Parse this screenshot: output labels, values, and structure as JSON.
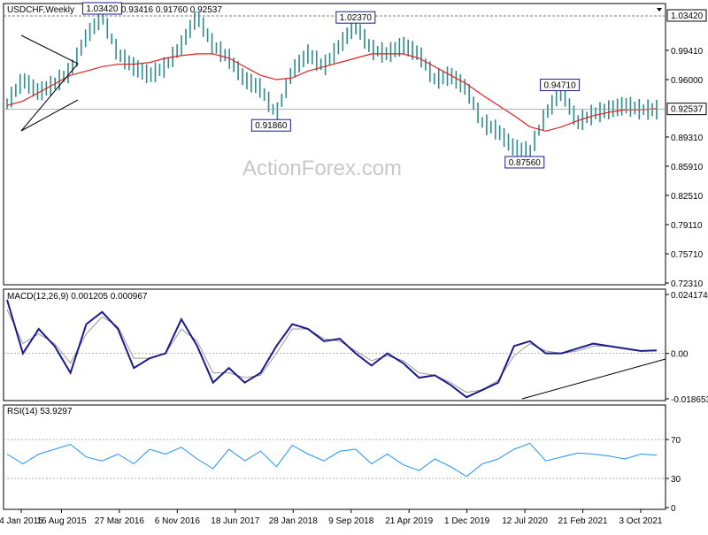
{
  "header": {
    "symbol": "USDCHF,Weekly",
    "ohlc": "0.93045 0.93416 0.91760 0.92537"
  },
  "watermark": "ActionForex.com",
  "colors": {
    "bars": "#2e8b8b",
    "ma": "#e02020",
    "macd": "#1a1a8c",
    "signal": "#999999",
    "rsi": "#1e90ff",
    "price_label_bg": "#1a1a8c"
  },
  "chart_data": [
    {
      "type": "line",
      "name": "price",
      "ylim": [
        0.7231,
        1.0342
      ],
      "y_ticks": [
        "0.99410",
        "0.96000",
        "0.92537",
        "0.89310",
        "0.85910",
        "0.82510",
        "0.79110",
        "0.75710",
        "0.72310"
      ],
      "current_price": "0.92537",
      "top_label": "1.03420",
      "annotations": [
        {
          "text": "1.03420",
          "value": 1.0342
        },
        {
          "text": "1.02370",
          "value": 1.0237
        },
        {
          "text": "0.91860",
          "value": 0.9186
        },
        {
          "text": "0.94710",
          "value": 0.9471
        },
        {
          "text": "0.87560",
          "value": 0.8756
        }
      ],
      "x_labels": [
        "4 Jan 2015",
        "16 Aug 2015",
        "27 Mar 2016",
        "6 Nov 2016",
        "18 Jun 2017",
        "28 Jan 2018",
        "9 Sep 2018",
        "21 Apr 2019",
        "1 Dec 2019",
        "12 Jul 2020",
        "21 Feb 2021",
        "3 Oct 2021"
      ],
      "series": [
        {
          "name": "USDCHF",
          "values": [
            0.932,
            0.96,
            0.945,
            0.955,
            0.97,
            1.01,
            1.0342,
            0.99,
            0.975,
            0.965,
            0.975,
            1.0,
            1.0342,
            1.0,
            0.985,
            0.96,
            0.95,
            0.9186,
            0.97,
            0.99,
            0.975,
            1.0,
            1.0237,
            0.995,
            0.99,
            1.0,
            0.99,
            0.96,
            0.965,
            0.95,
            0.91,
            0.9,
            0.88,
            0.8756,
            0.92,
            0.9471,
            0.91,
            0.92,
            0.925,
            0.93,
            0.925,
            0.925
          ]
        },
        {
          "name": "MA",
          "values": [
            0.93,
            0.935,
            0.945,
            0.955,
            0.965,
            0.97,
            0.975,
            0.978,
            0.978,
            0.98,
            0.985,
            0.988,
            0.99,
            0.99,
            0.985,
            0.975,
            0.965,
            0.96,
            0.962,
            0.97,
            0.975,
            0.98,
            0.985,
            0.99,
            0.99,
            0.99,
            0.985,
            0.975,
            0.965,
            0.955,
            0.942,
            0.93,
            0.918,
            0.905,
            0.9,
            0.905,
            0.912,
            0.918,
            0.922,
            0.925,
            0.925,
            0.926
          ]
        }
      ]
    },
    {
      "type": "line",
      "name": "macd",
      "title": "MACD(12,26,9) 0.001205 0.000967",
      "ylim": [
        -0.018653,
        0.024174
      ],
      "y_ticks": [
        "0.024174",
        "0.00",
        "-0.018653"
      ],
      "current_label": "0.00",
      "series": [
        {
          "name": "MACD",
          "values": [
            0.022,
            0.0,
            0.01,
            0.003,
            -0.008,
            0.012,
            0.017,
            0.01,
            -0.006,
            -0.002,
            0.0,
            0.014,
            0.003,
            -0.012,
            -0.006,
            -0.012,
            -0.008,
            0.003,
            0.012,
            0.01,
            0.005,
            0.006,
            0.0,
            -0.005,
            0.0,
            -0.004,
            -0.01,
            -0.009,
            -0.013,
            -0.018,
            -0.015,
            -0.012,
            0.003,
            0.005,
            0.0,
            0.0,
            0.002,
            0.004,
            0.003,
            0.002,
            0.001,
            0.0012
          ]
        },
        {
          "name": "Signal",
          "values": [
            0.018,
            0.004,
            0.008,
            0.004,
            -0.004,
            0.008,
            0.015,
            0.011,
            -0.002,
            -0.002,
            0.0,
            0.01,
            0.005,
            -0.008,
            -0.008,
            -0.01,
            -0.009,
            0.0,
            0.01,
            0.01,
            0.006,
            0.005,
            0.001,
            -0.003,
            -0.001,
            -0.003,
            -0.008,
            -0.009,
            -0.012,
            -0.016,
            -0.015,
            -0.011,
            -0.001,
            0.004,
            0.001,
            0.0,
            0.001,
            0.003,
            0.003,
            0.002,
            0.001,
            0.001
          ]
        }
      ]
    },
    {
      "type": "line",
      "name": "rsi",
      "title": "RSI(14) 53.9297",
      "ylim": [
        0,
        100
      ],
      "y_ticks": [
        "70",
        "30",
        "0"
      ],
      "levels": [
        70,
        30
      ],
      "series": [
        {
          "name": "RSI",
          "values": [
            55,
            45,
            55,
            60,
            65,
            52,
            48,
            55,
            45,
            60,
            55,
            62,
            50,
            40,
            60,
            48,
            58,
            42,
            64,
            55,
            48,
            58,
            60,
            45,
            55,
            44,
            38,
            50,
            42,
            32,
            45,
            50,
            60,
            66,
            48,
            52,
            56,
            55,
            53,
            50,
            55,
            53.93
          ]
        }
      ]
    }
  ]
}
